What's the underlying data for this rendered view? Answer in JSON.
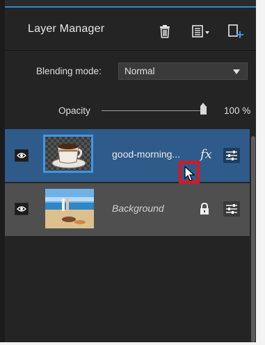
{
  "panel": {
    "title": "Layer Manager",
    "accent_color": "#2a89d6",
    "header_icons": [
      "trash-icon",
      "layer-menu-icon",
      "new-layer-icon"
    ]
  },
  "blending": {
    "label": "Blending mode:",
    "value": "Normal"
  },
  "opacity": {
    "label": "Opacity",
    "value_text": "100 %",
    "value": 100
  },
  "layers": [
    {
      "name": "good-morning...",
      "visible": true,
      "selected": true,
      "thumbnail": "coffee-cup-thumbnail",
      "effects_label": "fx",
      "properties_icon": "sliders-icon"
    },
    {
      "name": "Background",
      "visible": true,
      "selected": false,
      "thumbnail": "beach-photo-thumbnail",
      "locked_icon": "lock-icon",
      "properties_icon": "sliders-icon"
    }
  ],
  "colors": {
    "selected_row": "#2f5b8b",
    "background_row": "#4f4f4f",
    "highlight_box": "#e8111b"
  }
}
